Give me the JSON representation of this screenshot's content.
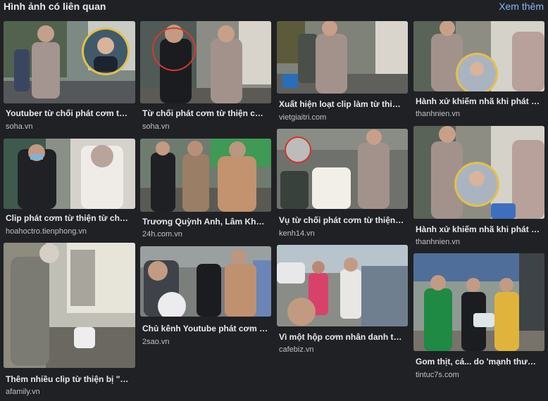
{
  "header": {
    "title": "Hình ảnh có liên quan",
    "more_label": "Xem thêm"
  },
  "colors": {
    "background": "#202124",
    "link": "#8ab4f8",
    "text": "#e8eaed",
    "source": "#bdc1c6"
  },
  "cards": [
    {
      "caption": "Youtuber từ chối phát cơm từ thiện...",
      "source": "soha.vn"
    },
    {
      "caption": "Clip phát cơm từ thiện từ chối ...",
      "source": "hoahoctro.tienphong.vn"
    },
    {
      "caption": "Thêm nhiều clip từ thiện bị \"phốt\"...",
      "source": "afamily.vn"
    },
    {
      "caption": "Từ chối phát cơm từ thiện cho người...",
      "source": "soha.vn"
    },
    {
      "caption": "Trương Quỳnh Anh, Lâm Khánh Chi...",
      "source": "24h.com.vn"
    },
    {
      "caption": "Chủ kênh Youtube phát cơm từ thiện...",
      "source": "2sao.vn"
    },
    {
      "caption": "Xuất hiện loạt clip làm từ thiện...",
      "source": "vietgiaitri.com"
    },
    {
      "caption": "Vụ từ chối phát cơm từ thiện cho...",
      "source": "kenh14.vn"
    },
    {
      "caption": "Vì một hộp cơm nhân danh từ thiện...",
      "source": "cafebiz.vn"
    },
    {
      "caption": "Hành xử khiếm nhã khi phát cơm...",
      "source": "thanhnien.vn"
    },
    {
      "caption": "Hành xử khiếm nhã khi phát cơm...",
      "source": "thanhnien.vn"
    },
    {
      "caption": "Gom thịt, cá... do 'mạnh thường quân'...",
      "source": "tintuc7s.com"
    }
  ]
}
